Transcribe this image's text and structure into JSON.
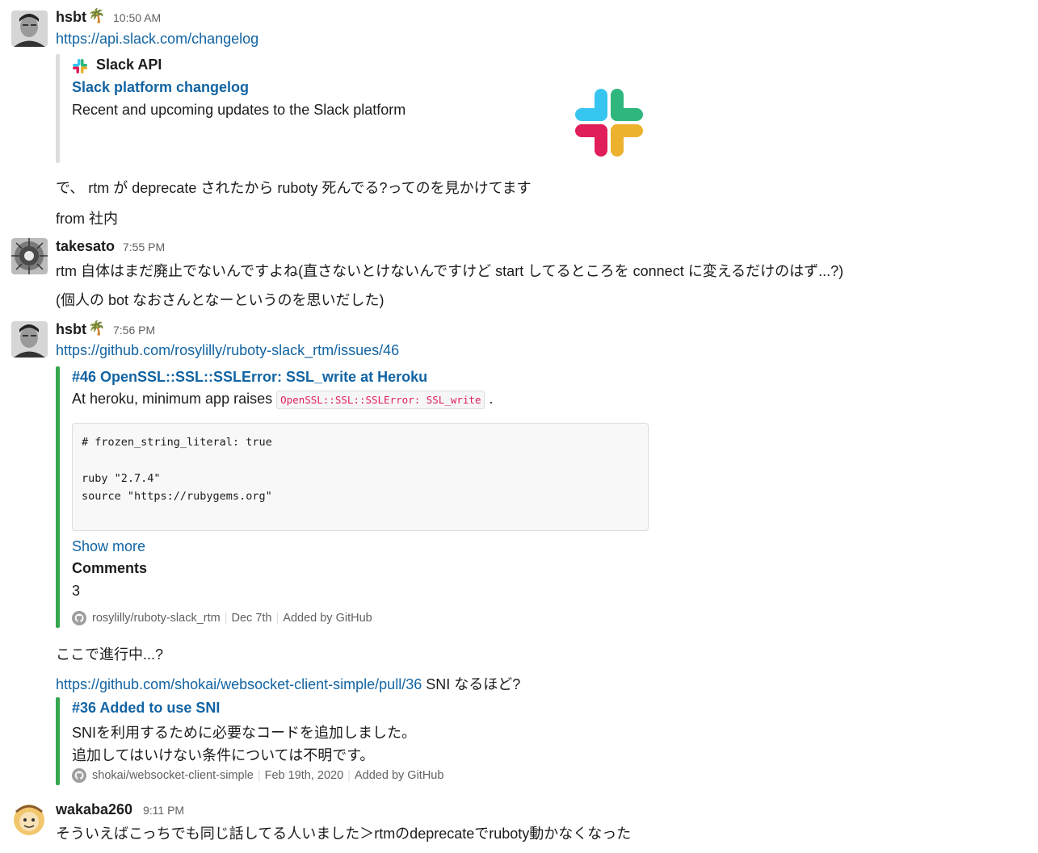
{
  "messages": {
    "m1": {
      "user": "hsbt",
      "status_emoji": "🌴",
      "time": "10:50 AM",
      "link": "https://api.slack.com/changelog",
      "unfurl": {
        "service": "Slack API",
        "title": "Slack platform changelog",
        "description": "Recent and upcoming updates to the Slack platform"
      },
      "text1": "で、 rtm が deprecate されたから ruboty 死んでる?ってのを見かけてます",
      "text2": "from 社内"
    },
    "m2": {
      "user": "takesato",
      "time": "7:55 PM",
      "text1": "rtm 自体はまだ廃止でないんですよね(直さないとけないんですけど start してるところを connect に変えるだけのはず...?)",
      "text2": "(個人の bot なおさんとなーというのを思いだした)"
    },
    "m3": {
      "user": "hsbt",
      "status_emoji": "🌴",
      "time": "7:56 PM",
      "link": "https://github.com/rosylilly/ruboty-slack_rtm/issues/46",
      "issue": {
        "title": "#46 OpenSSL::SSL::SSLError: SSL_write at Heroku",
        "desc_prefix": "At heroku, minimum app raises",
        "desc_code": "OpenSSL::SSL::SSLError: SSL_write",
        "desc_suffix": ".",
        "code_lines": [
          "# frozen_string_literal: true",
          "",
          "ruby \"2.7.4\"",
          "source \"https://rubygems.org\""
        ],
        "show_more": "Show more",
        "comments_label": "Comments",
        "comments_value": "3",
        "footer_repo": "rosylilly/ruboty-slack_rtm",
        "footer_date": "Dec 7th",
        "footer_added": "Added by GitHub"
      },
      "text_progress": "ここで進行中...?",
      "link2": "https://github.com/shokai/websocket-client-simple/pull/36",
      "link2_suffix": " SNI なるほど?",
      "pr": {
        "title": "#36 Added to use SNI",
        "line1": "SNIを利用するために必要なコードを追加しました。",
        "line2": "追加してはいけない条件については不明です。",
        "footer_repo": "shokai/websocket-client-simple",
        "footer_date": "Feb 19th, 2020",
        "footer_added": "Added by GitHub"
      }
    },
    "m4": {
      "user": "wakaba260",
      "time": "9:11 PM",
      "text1": "そういえばこっちでも同じ話してる人いました＞rtmのdeprecateでruboty動かなくなった"
    }
  },
  "colors": {
    "link": "#1264a3",
    "github_bar": "#36a64f",
    "unfurl_bar": "#dddddd",
    "code_inline": "#e01e5a",
    "timestamp": "#616061"
  },
  "icons": [
    "slack-logo-icon",
    "github-icon",
    "palm-tree-emoji"
  ]
}
